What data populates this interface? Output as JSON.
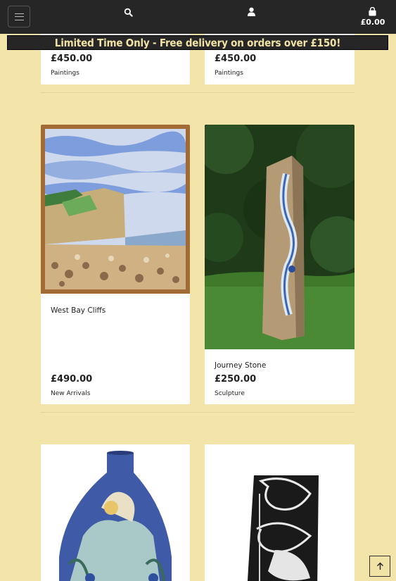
{
  "header": {
    "menu_icon": "hamburger-menu-icon",
    "search_icon": "search-icon",
    "account_icon": "user-icon",
    "cart_icon": "shopping-bag-icon",
    "cart_total": "£0.00"
  },
  "promo": {
    "text": "Limited Time Only - Free delivery on orders over £150!"
  },
  "products": [
    {
      "name": "",
      "price": "£450.00",
      "category": "Paintings"
    },
    {
      "name": "",
      "price": "£450.00",
      "category": "Paintings"
    },
    {
      "name": "West Bay Cliffs",
      "price": "£490.00",
      "category": "New Arrivals"
    },
    {
      "name": "Journey Stone",
      "price": "£250.00",
      "category": "Sculpture"
    },
    {
      "name": "",
      "price": "",
      "category": ""
    },
    {
      "name": "",
      "price": "",
      "category": ""
    }
  ],
  "colors": {
    "background": "#f3e4a9",
    "header": "#262626",
    "promo_text": "#f1e2a6"
  },
  "back_to_top": {
    "icon": "arrow-up-icon"
  }
}
